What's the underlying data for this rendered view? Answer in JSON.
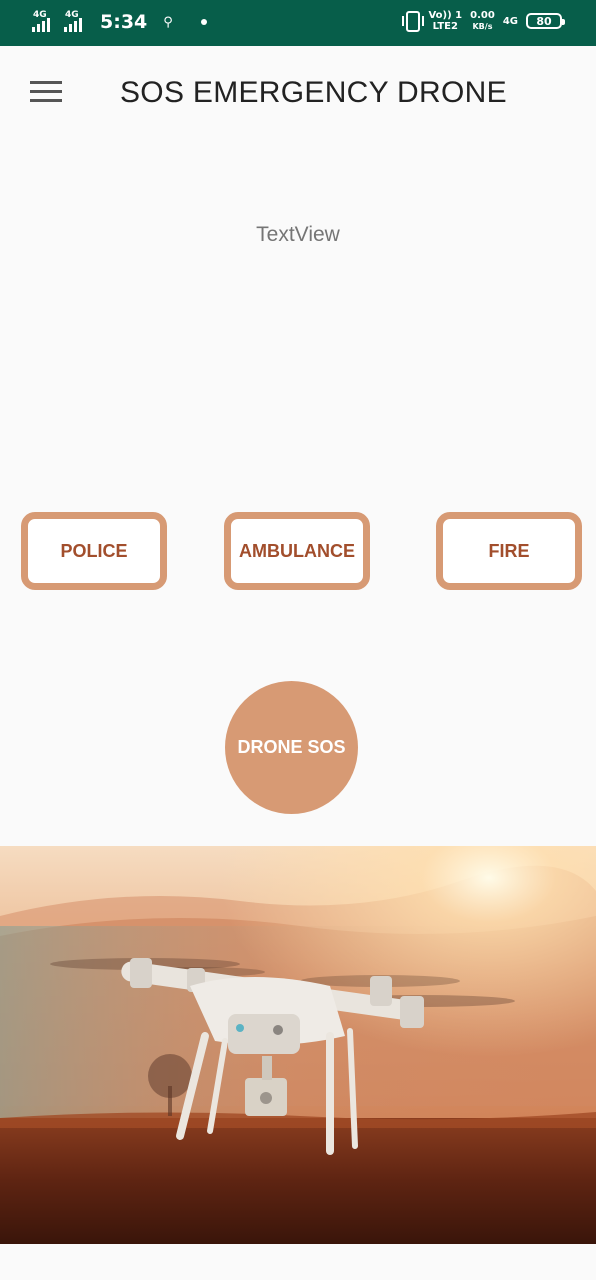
{
  "status_bar": {
    "network1": "4G",
    "network2": "4G",
    "time": "5:34",
    "volte_line1": "Vo)) 1",
    "volte_line2": "LTE2",
    "speed_value": "0.00",
    "speed_unit": "KB/s",
    "network3": "4G",
    "battery": "80"
  },
  "toolbar": {
    "title": "SOS EMERGENCY DRONE",
    "menu_icon": "hamburger-menu-icon"
  },
  "textview": "TextView",
  "buttons": {
    "police": "POLICE",
    "ambulance": "AMBULANCE",
    "fire": "FIRE",
    "drone_sos": "DRONE SOS"
  },
  "colors": {
    "status_bar": "#075e4a",
    "accent": "#d79a74",
    "button_text": "#a24e2c",
    "background": "#fafafa"
  }
}
